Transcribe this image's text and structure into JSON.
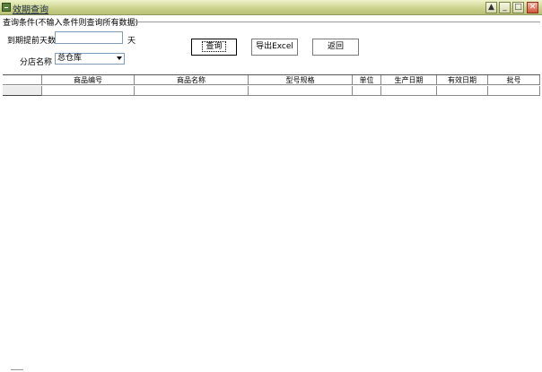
{
  "window": {
    "title": "效期查询",
    "controls": [
      {
        "name": "window-up-button",
        "glyph": "▲"
      },
      {
        "name": "window-minimize-button",
        "glyph": "_"
      },
      {
        "name": "window-maximize-button",
        "glyph": "□"
      },
      {
        "name": "window-close-button",
        "glyph": "✕"
      }
    ]
  },
  "query": {
    "group_label": "查询条件(不输入条件则查询所有数据)",
    "days_label": "到期提前天数",
    "days_value": "",
    "days_unit": "天",
    "branch_label": "分店名称",
    "branch_selected": "总仓库"
  },
  "buttons": {
    "query": "查询",
    "export": "导出Excel",
    "back": "返回"
  },
  "grid": {
    "columns": [
      "商品编号",
      "商品名称",
      "型号规格",
      "单位",
      "生产日期",
      "有效日期",
      "批号"
    ],
    "rows": [
      [
        "",
        "",
        "",
        "",
        "",
        "",
        ""
      ]
    ]
  }
}
